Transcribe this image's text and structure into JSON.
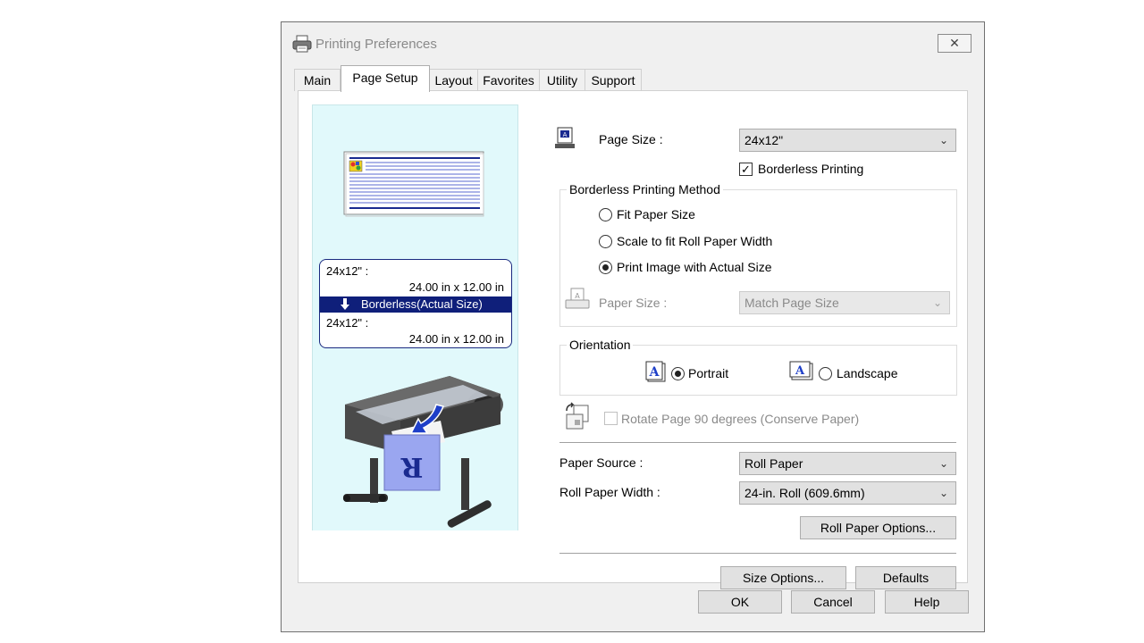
{
  "window": {
    "title": "Printing Preferences",
    "close": "✕"
  },
  "tabs": [
    {
      "label": "Main",
      "active": false
    },
    {
      "label": "Page Setup",
      "active": true
    },
    {
      "label": "Layout",
      "active": false
    },
    {
      "label": "Favorites",
      "active": false
    },
    {
      "label": "Utility",
      "active": false
    },
    {
      "label": "Support",
      "active": false
    }
  ],
  "preview": {
    "original_name": "24x12\" :",
    "original_dims": "24.00 in x 12.00 in",
    "mode": "Borderless(Actual Size)",
    "output_name": "24x12\" :",
    "output_dims": "24.00 in x 12.00 in",
    "printer_sheet_letter": "R"
  },
  "page_size": {
    "label": "Page Size :",
    "value": "24x12\"",
    "borderless_label": "Borderless Printing",
    "borderless_checked": true
  },
  "borderless_method": {
    "title": "Borderless Printing Method",
    "options": [
      {
        "label": "Fit Paper Size",
        "selected": false
      },
      {
        "label": "Scale to fit Roll Paper Width",
        "selected": false
      },
      {
        "label": "Print Image with Actual Size",
        "selected": true
      }
    ],
    "paper_size_label": "Paper Size :",
    "paper_size_value": "Match Page Size"
  },
  "orientation": {
    "title": "Orientation",
    "portrait_label": "Portrait",
    "landscape_label": "Landscape",
    "selected": "Portrait",
    "icon_glyph": "A"
  },
  "rotate": {
    "label": "Rotate Page 90 degrees (Conserve Paper)",
    "checked": false,
    "enabled": false
  },
  "paper_source": {
    "label": "Paper Source :",
    "value": "Roll Paper"
  },
  "roll_width": {
    "label": "Roll Paper Width :",
    "value": "24-in. Roll (609.6mm)"
  },
  "buttons": {
    "roll_options": "Roll Paper Options...",
    "size_options": "Size Options...",
    "defaults": "Defaults",
    "ok": "OK",
    "cancel": "Cancel",
    "help": "Help"
  },
  "icons": {
    "title": "printer-icon",
    "page_size": "page-size-icon",
    "paper_size": "paper-size-icon",
    "portrait": "portrait-icon",
    "landscape": "landscape-icon",
    "rotate": "rotate-page-icon",
    "dropdown": "chevron-down-icon",
    "down_arrow": "arrow-down-icon"
  },
  "colors": {
    "preview_bg": "#e1f9fb",
    "highlight": "#0f1f7a",
    "accent_blue": "#1e3fc8"
  }
}
